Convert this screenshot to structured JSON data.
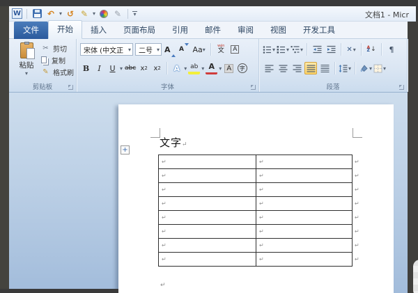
{
  "window": {
    "title": "文档1 - Micr"
  },
  "qat": {
    "undo_glyph": "↶",
    "redo_glyph": "↺",
    "pens_glyph": "✎",
    "draw_glyph": "✎",
    "dropdown_glyph": "▾",
    "word_logo_glyph": "W"
  },
  "tabs": {
    "file_label": "文件",
    "items": [
      {
        "label": "开始",
        "active": true
      },
      {
        "label": "插入",
        "active": false
      },
      {
        "label": "页面布局",
        "active": false
      },
      {
        "label": "引用",
        "active": false
      },
      {
        "label": "邮件",
        "active": false
      },
      {
        "label": "审阅",
        "active": false
      },
      {
        "label": "视图",
        "active": false
      },
      {
        "label": "开发工具",
        "active": false
      }
    ]
  },
  "ribbon": {
    "clipboard": {
      "group_label": "剪贴板",
      "paste_label": "粘贴",
      "cut_label": "剪切",
      "copy_label": "复制",
      "format_painter_label": "格式刷",
      "cut_glyph": "✂",
      "painter_glyph": "✎"
    },
    "font": {
      "group_label": "字体",
      "font_name_value": "宋体 (中文正",
      "font_size_value": "二号",
      "grow_glyph": "A",
      "shrink_glyph": "A",
      "case_glyph": "Aa",
      "phonetic_top": "wén",
      "phonetic_bottom": "文",
      "char_border_glyph": "A",
      "bold_glyph": "B",
      "italic_glyph": "I",
      "underline_glyph": "U",
      "strike_glyph": "abc",
      "subscript_glyph": "x",
      "subscript_sub": "2",
      "superscript_glyph": "x",
      "superscript_sup": "2",
      "effects_glyph": "A",
      "highlight_glyph": "ab",
      "color_glyph": "A",
      "shading_glyph": "A",
      "enclose_glyph": "字",
      "dropdown_glyph": "▾"
    },
    "paragraph": {
      "group_label": "段落",
      "asian_layout_glyph": "✕",
      "sort_a": "A",
      "sort_z": "Z",
      "sort_arrow": "↓",
      "show_hide_glyph": "¶",
      "dropdown_glyph": "▾"
    }
  },
  "document": {
    "heading": "文字",
    "heading_mark": "↵",
    "table": {
      "rows": 8,
      "cols": 2,
      "cell_mark": "↵",
      "end_mark": "↵"
    },
    "final_mark": "↵"
  },
  "colors": {
    "accent_blue": "#2b579a",
    "selection_orange": "#fed66a",
    "workspace_top": "#cddded",
    "workspace_bottom": "#a2bcdb",
    "frame_dark": "#3a3a3a"
  }
}
